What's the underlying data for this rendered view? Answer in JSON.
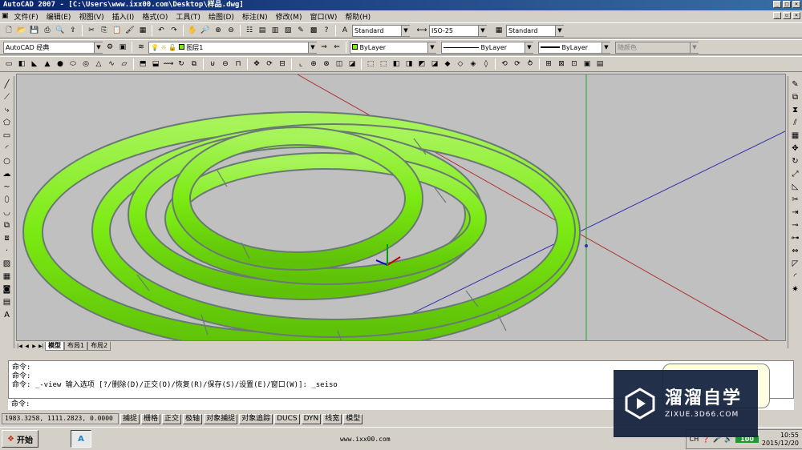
{
  "window": {
    "title": "AutoCAD 2007 - [C:\\Users\\www.ixx00.com\\Desktop\\样品.dwg]"
  },
  "menu": [
    "文件(F)",
    "编辑(E)",
    "视图(V)",
    "插入(I)",
    "格式(O)",
    "工具(T)",
    "绘图(D)",
    "标注(N)",
    "修改(M)",
    "窗口(W)",
    "帮助(H)"
  ],
  "styles": {
    "text_style": "Standard",
    "dim_style": "ISO-25",
    "table_style": "Standard"
  },
  "workspace": "AutoCAD 经典",
  "layer": {
    "name": "图层1"
  },
  "properties": {
    "color": "ByLayer",
    "linetype": "ByLayer",
    "lineweight": "ByLayer",
    "plotstyle": "随颜色"
  },
  "layout_tabs": [
    "模型",
    "布局1",
    "布局2"
  ],
  "command": {
    "history": [
      "命令:",
      "命令:",
      "命令: _-view 输入选项 [?/删除(D)/正交(O)/恢复(R)/保存(S)/设置(E)/窗口(W)]: _seiso"
    ],
    "prompt": "命令:"
  },
  "status": {
    "coordinates": "1983.3258, 1111.2823, 0.0000",
    "toggles": [
      "捕捉",
      "栅格",
      "正交",
      "极轴",
      "对象捕捉",
      "对象追踪",
      "DUCS",
      "DYN",
      "线宽",
      "模型"
    ]
  },
  "taskbar": {
    "start_label": "开始",
    "center_text": "www.ixx00.com",
    "lang": "CH",
    "battery": "100",
    "time": "10:55",
    "date": "2015/12/20"
  },
  "watermark": {
    "title": "溜溜自学",
    "subtitle": "ZIXUE.3D66.COM"
  },
  "colors": {
    "model_green": "#7bea12",
    "model_edge": "#6a7a72",
    "viewport_bg": "#c0c0c0",
    "ucs_x": "#c00000",
    "ucs_y": "#00a000",
    "ucs_z": "#0000c0"
  }
}
